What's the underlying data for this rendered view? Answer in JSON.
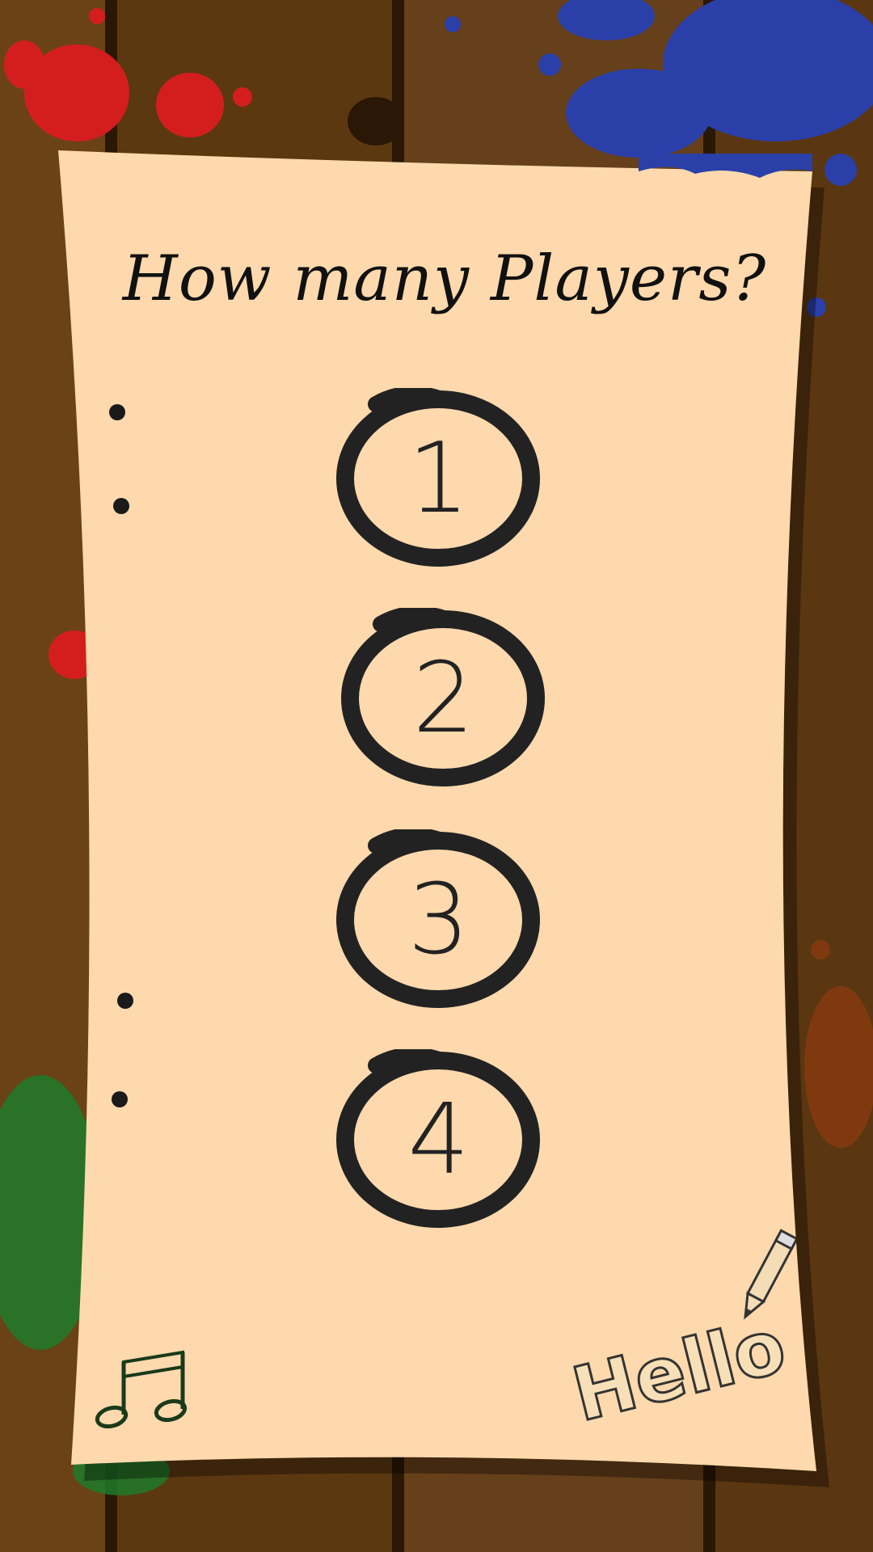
{
  "title": "How many Players?",
  "player_options": [
    {
      "label": "1"
    },
    {
      "label": "2"
    },
    {
      "label": "3"
    },
    {
      "label": "4"
    }
  ],
  "hello_button": "Hello",
  "icons": {
    "music": "music-note-icon",
    "pencil": "pencil-icon"
  },
  "colors": {
    "paper": "#fdd9ad",
    "wood": "#5a3510",
    "ink": "#222222",
    "paint_red": "#d41e1e",
    "paint_blue": "#2b3fa8",
    "paint_green": "#1f7a2a"
  }
}
